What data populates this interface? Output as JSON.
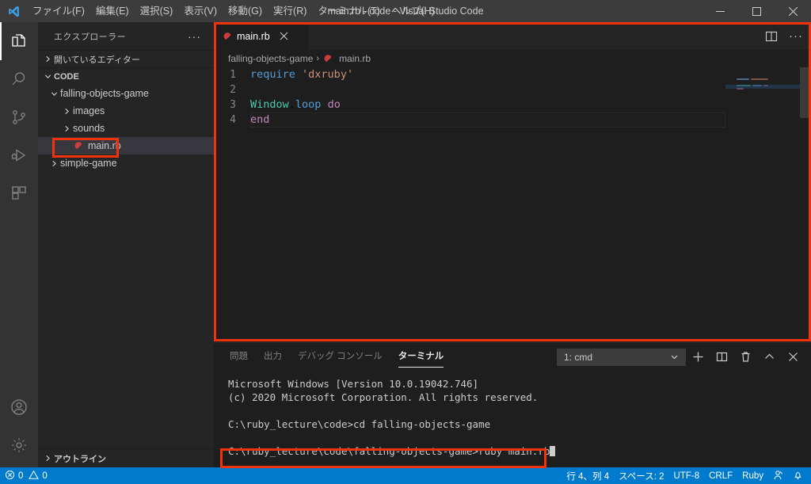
{
  "window": {
    "title": "main.rb - code - Visual Studio Code",
    "logo_icon": "vscode-logo",
    "minimize_label": "─",
    "maximize_label": "□",
    "close_label": "✕"
  },
  "menu": {
    "items": [
      {
        "label": "ファイル(F)"
      },
      {
        "label": "編集(E)"
      },
      {
        "label": "選択(S)"
      },
      {
        "label": "表示(V)"
      },
      {
        "label": "移動(G)"
      },
      {
        "label": "実行(R)"
      },
      {
        "label": "ターミナル(T)"
      },
      {
        "label": "ヘルプ(H)"
      }
    ]
  },
  "activitybar": {
    "top": [
      {
        "name": "explorer",
        "icon": "files-icon",
        "active": true
      },
      {
        "name": "search",
        "icon": "search-icon",
        "active": false
      },
      {
        "name": "source-control",
        "icon": "source-control-icon",
        "active": false
      },
      {
        "name": "run-debug",
        "icon": "run-debug-icon",
        "active": false
      },
      {
        "name": "extensions",
        "icon": "extensions-icon",
        "active": false
      }
    ],
    "bottom": [
      {
        "name": "accounts",
        "icon": "account-icon"
      },
      {
        "name": "settings",
        "icon": "gear-icon"
      }
    ]
  },
  "sidebar": {
    "title": "エクスプローラー",
    "more_actions": "···",
    "open_editors_label": "開いているエディター",
    "workspace_label": "CODE",
    "tree": [
      {
        "label": "falling-objects-game",
        "type": "folder",
        "expanded": true,
        "depth": 1
      },
      {
        "label": "images",
        "type": "folder",
        "expanded": false,
        "depth": 2
      },
      {
        "label": "sounds",
        "type": "folder",
        "expanded": false,
        "depth": 2
      },
      {
        "label": "main.rb",
        "type": "ruby-file",
        "selected": true,
        "depth": 2
      },
      {
        "label": "simple-game",
        "type": "folder",
        "expanded": false,
        "depth": 1
      }
    ],
    "outline_label": "アウトライン"
  },
  "editor": {
    "tab": {
      "label": "main.rb",
      "icon": "ruby-icon",
      "close_icon": "close-icon"
    },
    "actions": [
      {
        "name": "split-editor",
        "icon": "split-editor-icon"
      },
      {
        "name": "more-actions",
        "icon": "ellipsis-icon",
        "label": "···"
      }
    ],
    "breadcrumb": [
      {
        "label": "falling-objects-game",
        "icon": null
      },
      {
        "label": "main.rb",
        "icon": "ruby-icon"
      }
    ],
    "breadcrumb_separator": "›",
    "lines": [
      {
        "no": "1",
        "tokens": [
          {
            "t": "require",
            "c": "kw"
          },
          {
            "t": " ",
            "c": "plain"
          },
          {
            "t": "'dxruby'",
            "c": "str"
          }
        ]
      },
      {
        "no": "2",
        "tokens": []
      },
      {
        "no": "3",
        "tokens": [
          {
            "t": "Window",
            "c": "cls"
          },
          {
            "t": ".",
            "c": "plain"
          },
          {
            "t": "loop",
            "c": "kw"
          },
          {
            "t": " ",
            "c": "plain"
          },
          {
            "t": "do",
            "c": "ctl"
          }
        ]
      },
      {
        "no": "4",
        "tokens": [
          {
            "t": "end",
            "c": "ctl"
          }
        ]
      }
    ]
  },
  "panel": {
    "tabs": [
      {
        "label": "問題",
        "active": false
      },
      {
        "label": "出力",
        "active": false
      },
      {
        "label": "デバッグ コンソール",
        "active": false
      },
      {
        "label": "ターミナル",
        "active": true
      }
    ],
    "terminal_select_value": "1: cmd",
    "actions": [
      {
        "name": "new-terminal",
        "icon": "plus-icon"
      },
      {
        "name": "split-terminal",
        "icon": "split-icon"
      },
      {
        "name": "kill-terminal",
        "icon": "trash-icon"
      },
      {
        "name": "maximize-panel",
        "icon": "chevron-up-icon"
      },
      {
        "name": "close-panel",
        "icon": "close-icon"
      }
    ],
    "terminal_lines": [
      "Microsoft Windows [Version 10.0.19042.746]",
      "(c) 2020 Microsoft Corporation. All rights reserved.",
      "",
      "C:\\ruby_lecture\\code>cd falling-objects-game"
    ],
    "terminal_prompt": "C:\\ruby_lecture\\code\\falling-objects-game>ruby main.rb"
  },
  "statusbar": {
    "left": [
      {
        "name": "problems",
        "error_icon": "error-circle-icon",
        "errors": "0",
        "warning_icon": "warning-triangle-icon",
        "warnings": "0"
      }
    ],
    "right": [
      {
        "name": "cursor-position",
        "label": "行 4、列 4"
      },
      {
        "name": "indentation",
        "label": "スペース: 2"
      },
      {
        "name": "encoding",
        "label": "UTF-8"
      },
      {
        "name": "eol",
        "label": "CRLF"
      },
      {
        "name": "language-mode",
        "label": "Ruby"
      },
      {
        "name": "feedback",
        "icon": "feedback-icon"
      },
      {
        "name": "notifications",
        "icon": "bell-icon"
      }
    ]
  },
  "annotations": {
    "color": "#f2320a",
    "boxes": [
      {
        "name": "editor-highlight"
      },
      {
        "name": "file-highlight"
      },
      {
        "name": "terminal-command-highlight"
      }
    ]
  },
  "colors": {
    "accent": "#007acc",
    "annotation": "#f2320a",
    "keyword": "#569cd6",
    "string": "#ce9178",
    "class": "#4ec9b0",
    "control": "#c586c0"
  }
}
